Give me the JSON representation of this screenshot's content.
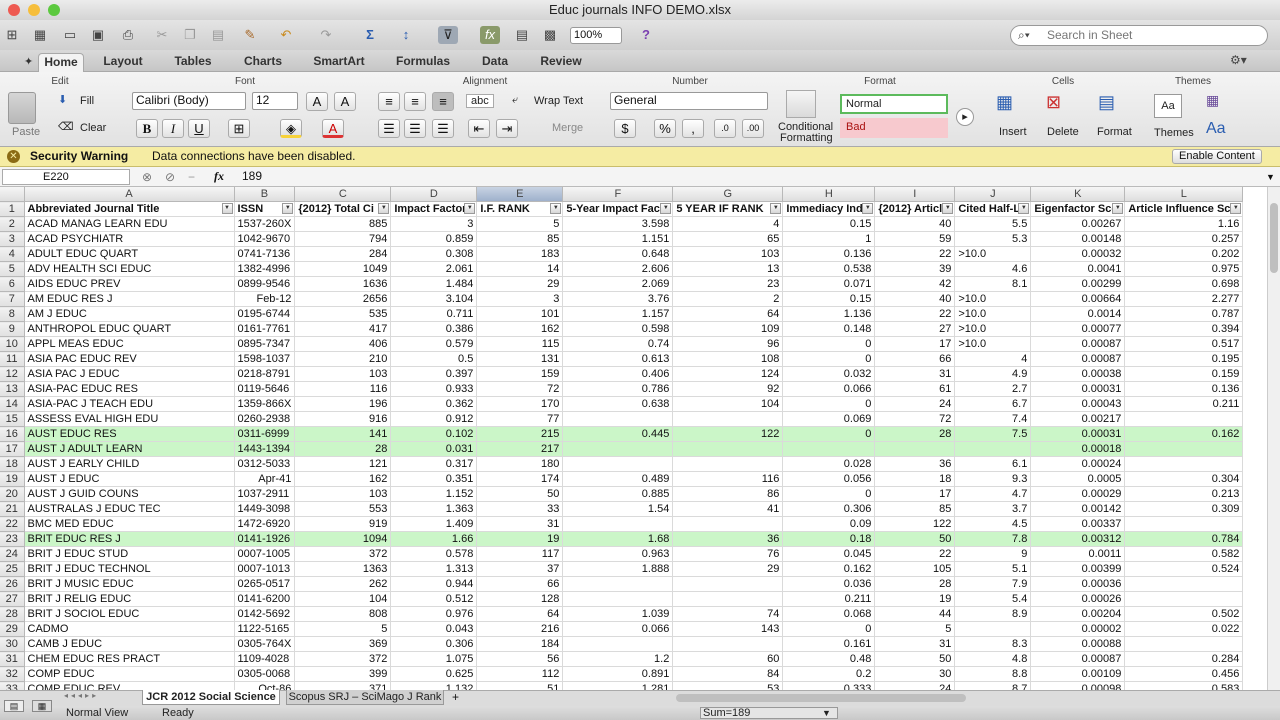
{
  "window": {
    "title": "Educ journals INFO DEMO.xlsx"
  },
  "toolbar": {
    "zoom": "100%",
    "search_placeholder": "Search in Sheet"
  },
  "tabs": [
    "Home",
    "Layout",
    "Tables",
    "Charts",
    "SmartArt",
    "Formulas",
    "Data",
    "Review"
  ],
  "ribbon": {
    "groups": [
      "Edit",
      "Font",
      "Alignment",
      "Number",
      "Format",
      "Cells",
      "Themes"
    ],
    "fill": "Fill",
    "clear": "Clear",
    "paste": "Paste",
    "font_name": "Calibri (Body)",
    "font_size": "12",
    "abc": "abc",
    "wrap_text": "Wrap Text",
    "merge": "Merge",
    "number_format": "General",
    "conditional": "Conditional",
    "formatting": "Formatting",
    "style_normal": "Normal",
    "style_bad": "Bad",
    "insert": "Insert",
    "delete": "Delete",
    "format": "Format",
    "themes": "Themes"
  },
  "security": {
    "title": "Security Warning",
    "message": "Data connections have been disabled.",
    "button": "Enable Content"
  },
  "formula_bar": {
    "cell_ref": "E220",
    "fx": "fx",
    "value": "189"
  },
  "columns": [
    "A",
    "B",
    "C",
    "D",
    "E",
    "F",
    "G",
    "H",
    "I",
    "J",
    "K",
    "L"
  ],
  "headers": [
    "Abbreviated Journal Title",
    "ISSN",
    "{2012} Total Ci",
    "Impact Factor",
    "I.F. RANK",
    "5-Year Impact Fact",
    "5 YEAR IF RANK",
    "Immediacy Ind",
    "{2012} Articl",
    "Cited Half-Li",
    "Eigenfactor Sco",
    "Article Influence Sco"
  ],
  "rows": [
    [
      "2",
      false,
      "ACAD MANAG LEARN EDU",
      "1537-260X",
      "885",
      "3",
      "5",
      "3.598",
      "4",
      "0.15",
      "40",
      "5.5",
      "0.00267",
      "1.16"
    ],
    [
      "3",
      false,
      "ACAD PSYCHIATR",
      "1042-9670",
      "794",
      "0.859",
      "85",
      "1.151",
      "65",
      "1",
      "59",
      "5.3",
      "0.00148",
      "0.257"
    ],
    [
      "4",
      false,
      "ADULT EDUC QUART",
      "0741-7136",
      "284",
      "0.308",
      "183",
      "0.648",
      "103",
      "0.136",
      "22",
      ">10.0",
      "0.00032",
      "0.202"
    ],
    [
      "5",
      false,
      "ADV HEALTH SCI EDUC",
      "1382-4996",
      "1049",
      "2.061",
      "14",
      "2.606",
      "13",
      "0.538",
      "39",
      "4.6",
      "0.0041",
      "0.975"
    ],
    [
      "6",
      false,
      "AIDS EDUC PREV",
      "0899-9546",
      "1636",
      "1.484",
      "29",
      "2.069",
      "23",
      "0.071",
      "42",
      "8.1",
      "0.00299",
      "0.698"
    ],
    [
      "7",
      false,
      "AM EDUC RES J",
      "Feb-12",
      "2656",
      "3.104",
      "3",
      "3.76",
      "2",
      "0.15",
      "40",
      ">10.0",
      "0.00664",
      "2.277"
    ],
    [
      "8",
      false,
      "AM J EDUC",
      "0195-6744",
      "535",
      "0.711",
      "101",
      "1.157",
      "64",
      "1.136",
      "22",
      ">10.0",
      "0.0014",
      "0.787"
    ],
    [
      "9",
      false,
      "ANTHROPOL EDUC QUART",
      "0161-7761",
      "417",
      "0.386",
      "162",
      "0.598",
      "109",
      "0.148",
      "27",
      ">10.0",
      "0.00077",
      "0.394"
    ],
    [
      "10",
      false,
      "APPL MEAS EDUC",
      "0895-7347",
      "406",
      "0.579",
      "115",
      "0.74",
      "96",
      "0",
      "17",
      ">10.0",
      "0.00087",
      "0.517"
    ],
    [
      "11",
      false,
      "ASIA PAC EDUC REV",
      "1598-1037",
      "210",
      "0.5",
      "131",
      "0.613",
      "108",
      "0",
      "66",
      "4",
      "0.00087",
      "0.195"
    ],
    [
      "12",
      false,
      "ASIA PAC J EDUC",
      "0218-8791",
      "103",
      "0.397",
      "159",
      "0.406",
      "124",
      "0.032",
      "31",
      "4.9",
      "0.00038",
      "0.159"
    ],
    [
      "13",
      false,
      "ASIA-PAC EDUC RES",
      "0119-5646",
      "116",
      "0.933",
      "72",
      "0.786",
      "92",
      "0.066",
      "61",
      "2.7",
      "0.00031",
      "0.136"
    ],
    [
      "14",
      false,
      "ASIA-PAC J TEACH EDU",
      "1359-866X",
      "196",
      "0.362",
      "170",
      "0.638",
      "104",
      "0",
      "24",
      "6.7",
      "0.00043",
      "0.211"
    ],
    [
      "15",
      false,
      "ASSESS EVAL HIGH EDU",
      "0260-2938",
      "916",
      "0.912",
      "77",
      "",
      "",
      "0.069",
      "72",
      "7.4",
      "0.00217",
      ""
    ],
    [
      "16",
      true,
      "AUST EDUC RES",
      "0311-6999",
      "141",
      "0.102",
      "215",
      "0.445",
      "122",
      "0",
      "28",
      "7.5",
      "0.00031",
      "0.162"
    ],
    [
      "17",
      true,
      "AUST J ADULT LEARN",
      "1443-1394",
      "28",
      "0.031",
      "217",
      "",
      "",
      "",
      "",
      "",
      "0.00018",
      ""
    ],
    [
      "18",
      false,
      "AUST J EARLY CHILD",
      "0312-5033",
      "121",
      "0.317",
      "180",
      "",
      "",
      "0.028",
      "36",
      "6.1",
      "0.00024",
      ""
    ],
    [
      "19",
      false,
      "AUST J EDUC",
      "Apr-41",
      "162",
      "0.351",
      "174",
      "0.489",
      "116",
      "0.056",
      "18",
      "9.3",
      "0.0005",
      "0.304"
    ],
    [
      "20",
      false,
      "AUST J GUID COUNS",
      "1037-2911",
      "103",
      "1.152",
      "50",
      "0.885",
      "86",
      "0",
      "17",
      "4.7",
      "0.00029",
      "0.213"
    ],
    [
      "21",
      false,
      "AUSTRALAS J EDUC TEC",
      "1449-3098",
      "553",
      "1.363",
      "33",
      "1.54",
      "41",
      "0.306",
      "85",
      "3.7",
      "0.00142",
      "0.309"
    ],
    [
      "22",
      false,
      "BMC MED EDUC",
      "1472-6920",
      "919",
      "1.409",
      "31",
      "",
      "",
      "0.09",
      "122",
      "4.5",
      "0.00337",
      ""
    ],
    [
      "23",
      true,
      "BRIT EDUC RES J",
      "0141-1926",
      "1094",
      "1.66",
      "19",
      "1.68",
      "36",
      "0.18",
      "50",
      "7.8",
      "0.00312",
      "0.784"
    ],
    [
      "24",
      false,
      "BRIT J EDUC STUD",
      "0007-1005",
      "372",
      "0.578",
      "117",
      "0.963",
      "76",
      "0.045",
      "22",
      "9",
      "0.0011",
      "0.582"
    ],
    [
      "25",
      false,
      "BRIT J EDUC TECHNOL",
      "0007-1013",
      "1363",
      "1.313",
      "37",
      "1.888",
      "29",
      "0.162",
      "105",
      "5.1",
      "0.00399",
      "0.524"
    ],
    [
      "26",
      false,
      "BRIT J MUSIC EDUC",
      "0265-0517",
      "262",
      "0.944",
      "66",
      "",
      "",
      "0.036",
      "28",
      "7.9",
      "0.00036",
      ""
    ],
    [
      "27",
      false,
      "BRIT J RELIG EDUC",
      "0141-6200",
      "104",
      "0.512",
      "128",
      "",
      "",
      "0.211",
      "19",
      "5.4",
      "0.00026",
      ""
    ],
    [
      "28",
      false,
      "BRIT J SOCIOL EDUC",
      "0142-5692",
      "808",
      "0.976",
      "64",
      "1.039",
      "74",
      "0.068",
      "44",
      "8.9",
      "0.00204",
      "0.502"
    ],
    [
      "29",
      false,
      "CADMO",
      "1122-5165",
      "5",
      "0.043",
      "216",
      "0.066",
      "143",
      "0",
      "5",
      "",
      "0.00002",
      "0.022"
    ],
    [
      "30",
      false,
      "CAMB J EDUC",
      "0305-764X",
      "369",
      "0.306",
      "184",
      "",
      "",
      "0.161",
      "31",
      "8.3",
      "0.00088",
      ""
    ],
    [
      "31",
      false,
      "CHEM EDUC RES PRACT",
      "1109-4028",
      "372",
      "1.075",
      "56",
      "1.2",
      "60",
      "0.48",
      "50",
      "4.8",
      "0.00087",
      "0.284"
    ],
    [
      "32",
      false,
      "COMP EDUC",
      "0305-0068",
      "399",
      "0.625",
      "112",
      "0.891",
      "84",
      "0.2",
      "30",
      "8.8",
      "0.00109",
      "0.456"
    ],
    [
      "33",
      false,
      "COMP EDUC REV",
      "Oct-86",
      "371",
      "1.132",
      "51",
      "1.281",
      "53",
      "0.333",
      "24",
      "8.7",
      "0.00098",
      "0.583"
    ]
  ],
  "sheets": [
    "JCR 2012 Social Science",
    "Scopus SRJ – SciMago J Rank"
  ],
  "status": {
    "view": "Normal View",
    "ready": "Ready",
    "sum": "Sum=189"
  }
}
